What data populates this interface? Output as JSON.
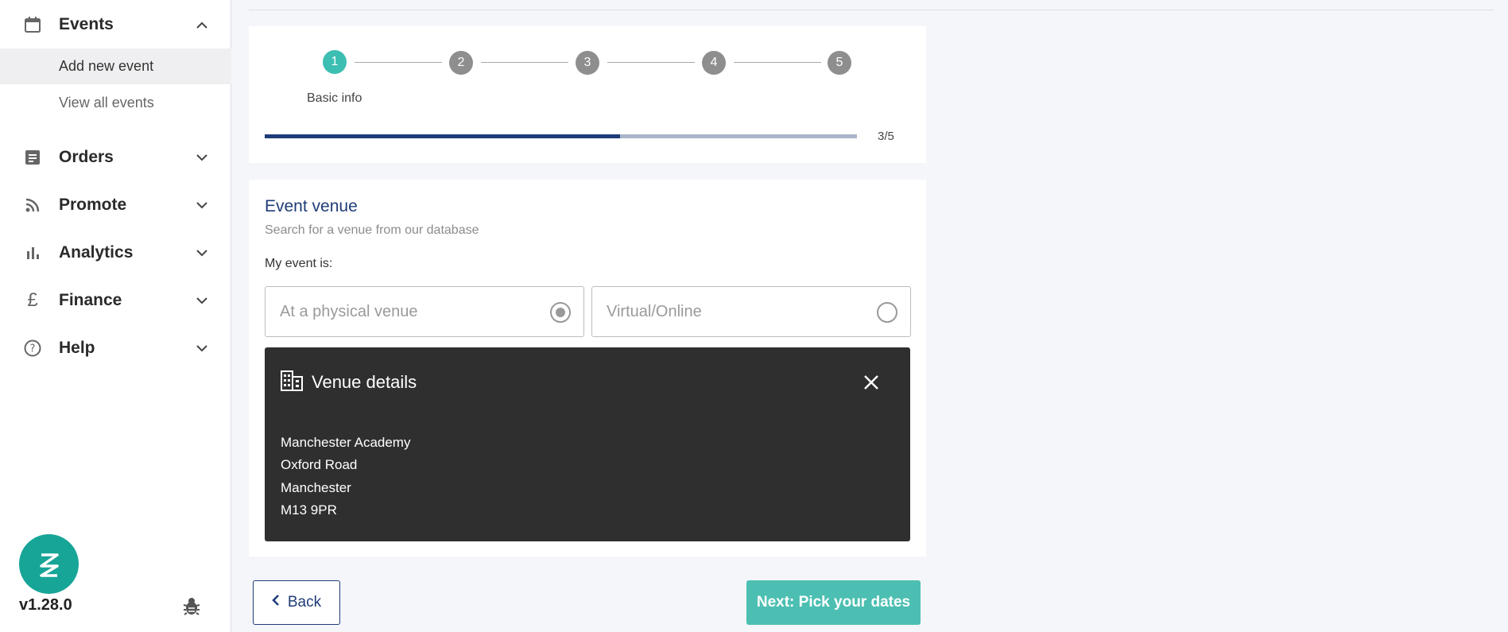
{
  "sidebar": {
    "groups": [
      {
        "label": "Events",
        "icon": "calendar-icon",
        "expanded": true
      },
      {
        "label": "Orders",
        "icon": "document-icon",
        "expanded": false
      },
      {
        "label": "Promote",
        "icon": "rss-icon",
        "expanded": false
      },
      {
        "label": "Analytics",
        "icon": "bar-chart-icon",
        "expanded": false
      },
      {
        "label": "Finance",
        "icon": "pound-icon",
        "expanded": false
      },
      {
        "label": "Help",
        "icon": "help-icon",
        "expanded": false
      }
    ],
    "events_sub": [
      {
        "label": "Add new event",
        "active": true
      },
      {
        "label": "View all events",
        "active": false
      }
    ],
    "version": "v1.28.0"
  },
  "stepper": {
    "steps": [
      "1",
      "2",
      "3",
      "4",
      "5"
    ],
    "active_step": 1,
    "caption": "Basic info",
    "progress_fraction": 0.6,
    "progress_text": "3/5"
  },
  "venue": {
    "title": "Event venue",
    "subtitle": "Search for a venue from our database",
    "my_event_label": "My event is:",
    "options": [
      {
        "label": "At a physical venue",
        "selected": true
      },
      {
        "label": "Virtual/Online",
        "selected": false
      }
    ],
    "details": {
      "title": "Venue details",
      "address": [
        "Manchester Academy",
        "Oxford Road",
        "Manchester",
        "M13 9PR"
      ]
    }
  },
  "footer": {
    "back_label": "Back",
    "next_label": "Next: Pick your dates"
  },
  "colors": {
    "accent_teal": "#3cbfb2",
    "brand_navy": "#1f3c78",
    "panel_dark": "#2f2f2f"
  }
}
